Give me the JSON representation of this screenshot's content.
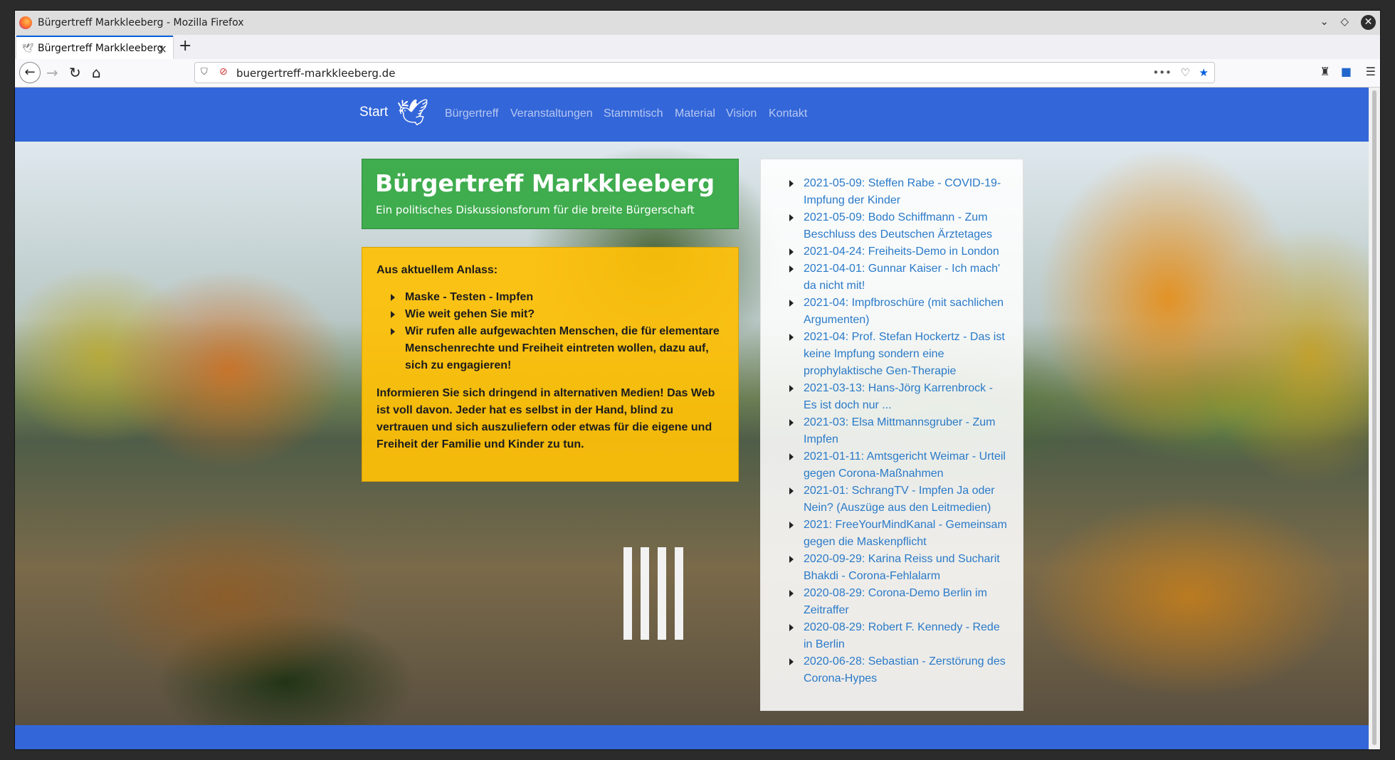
{
  "window": {
    "title": "Bürgertreff Markkleeberg - Mozilla Firefox"
  },
  "tab": {
    "title": "Bürgertreff Markkleeberg"
  },
  "url": "buergertreff-markkleeberg.de",
  "site": {
    "brand": "Start",
    "nav": [
      "Bürgertreff",
      "Veranstaltungen",
      "Stammtisch",
      "Material",
      "Vision",
      "Kontakt"
    ],
    "hero": {
      "title": "Bürgertreff Markkleeberg",
      "subtitle": "Ein politisches Diskussionsforum für die breite Bürgerschaft"
    },
    "notice": {
      "lead": "Aus aktuellem Anlass:",
      "items": [
        "Maske - Testen - Impfen",
        "Wie weit gehen Sie mit?",
        "Wir rufen alle aufgewachten Menschen, die für elementare Menschenrechte und Freiheit eintreten wollen, dazu auf, sich zu engagieren!"
      ],
      "body": "Informieren Sie sich dringend in alternativen Medien! Das Web ist voll davon. Jeder hat es selbst in der Hand, blind zu vertrauen und sich auszuliefern oder etwas für die eigene und Freiheit der Familie und Kinder zu tun."
    },
    "news": [
      "2021-05-09: Steffen Rabe - COVID-19-Impfung der Kinder",
      "2021-05-09: Bodo Schiffmann - Zum Beschluss des Deutschen Ärztetages",
      "2021-04-24: Freiheits-Demo in London",
      "2021-04-01: Gunnar Kaiser - Ich mach' da nicht mit!",
      "2021-04: Impfbroschüre (mit sachlichen Argumenten)",
      "2021-04: Prof. Stefan Hockertz - Das ist keine Impfung sondern eine prophylaktische Gen-Therapie",
      "2021-03-13: Hans-Jörg Karrenbrock - Es ist doch nur ...",
      "2021-03: Elsa Mittmannsgruber - Zum Impfen",
      "2021-01-11: Amtsgericht Weimar - Urteil gegen Corona-Maßnahmen",
      "2021-01: SchrangTV - Impfen Ja oder Nein? (Auszüge aus den Leitmedien)",
      "2021: FreeYourMindKanal - Gemeinsam gegen die Maskenpflicht",
      "2020-09-29: Karina Reiss und Sucharit Bhakdi - Corona-Fehlalarm",
      "2020-08-29: Corona-Demo Berlin im Zeitraffer",
      "2020-08-29: Robert F. Kennedy - Rede in Berlin",
      "2020-06-28: Sebastian - Zerstörung des Corona-Hypes"
    ]
  }
}
